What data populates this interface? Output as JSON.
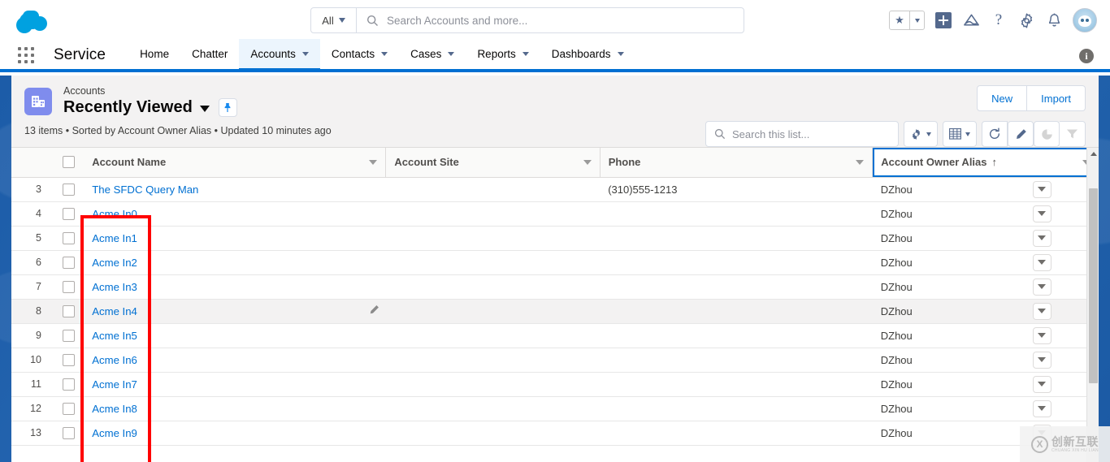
{
  "header": {
    "logo_icon": "salesforce-cloud-logo",
    "search": {
      "scope_label": "All",
      "placeholder": "Search Accounts and more...",
      "value": "",
      "search_icon": "search-icon"
    },
    "icons": [
      {
        "name": "favorites-star-icon",
        "glyph": "★"
      },
      {
        "name": "favorites-dropdown-icon",
        "glyph": ""
      },
      {
        "name": "add-icon",
        "glyph": "+"
      },
      {
        "name": "trailhead-icon",
        "glyph": ""
      },
      {
        "name": "help-icon",
        "glyph": "?"
      },
      {
        "name": "setup-gear-icon",
        "glyph": ""
      },
      {
        "name": "notifications-bell-icon",
        "glyph": ""
      },
      {
        "name": "user-avatar",
        "glyph": ""
      }
    ]
  },
  "nav": {
    "app_launcher_icon": "app-launcher-grid-icon",
    "app_name": "Service",
    "info_icon_label": "i",
    "tabs": [
      {
        "label": "Home",
        "has_chevron": false,
        "active": false
      },
      {
        "label": "Chatter",
        "has_chevron": false,
        "active": false
      },
      {
        "label": "Accounts",
        "has_chevron": true,
        "active": true
      },
      {
        "label": "Contacts",
        "has_chevron": true,
        "active": false
      },
      {
        "label": "Cases",
        "has_chevron": true,
        "active": false
      },
      {
        "label": "Reports",
        "has_chevron": true,
        "active": false
      },
      {
        "label": "Dashboards",
        "has_chevron": true,
        "active": false
      }
    ]
  },
  "list_view": {
    "object_icon": "account-building-icon",
    "breadcrumb": "Accounts",
    "title": "Recently Viewed",
    "pin_icon": "pin-icon",
    "meta": "13 items • Sorted by Account Owner Alias • Updated 10 minutes ago",
    "buttons": {
      "new_label": "New",
      "import_label": "Import"
    },
    "search": {
      "placeholder": "Search this list...",
      "value": "",
      "search_icon": "search-icon"
    },
    "tools": [
      {
        "name": "list-view-controls-gear",
        "icon": "gear-icon",
        "has_caret": true,
        "disabled": false
      },
      {
        "name": "display-as-table",
        "icon": "table-icon",
        "has_caret": true,
        "disabled": false
      },
      {
        "name": "refresh-button",
        "icon": "refresh-icon",
        "has_caret": false,
        "disabled": false
      },
      {
        "name": "edit-button",
        "icon": "pencil-icon",
        "has_caret": false,
        "disabled": false
      },
      {
        "name": "charts-button",
        "icon": "chart-icon",
        "has_caret": false,
        "disabled": true
      },
      {
        "name": "filter-button",
        "icon": "filter-icon",
        "has_caret": false,
        "disabled": true
      }
    ]
  },
  "table": {
    "select_all_checkbox": false,
    "columns": [
      {
        "key": "name",
        "label": "Account Name",
        "sorted": false,
        "sort_dir": ""
      },
      {
        "key": "site",
        "label": "Account Site",
        "sorted": false,
        "sort_dir": ""
      },
      {
        "key": "phone",
        "label": "Phone",
        "sorted": false,
        "sort_dir": ""
      },
      {
        "key": "owner",
        "label": "Account Owner Alias",
        "sorted": true,
        "sort_dir": "↑"
      }
    ],
    "rows": [
      {
        "num": "3",
        "name": "The SFDC Query Man",
        "site": "",
        "phone": "(310)555-1213",
        "owner": "DZhou",
        "hover": false
      },
      {
        "num": "4",
        "name": "Acme In0",
        "site": "",
        "phone": "",
        "owner": "DZhou",
        "hover": false
      },
      {
        "num": "5",
        "name": "Acme In1",
        "site": "",
        "phone": "",
        "owner": "DZhou",
        "hover": false
      },
      {
        "num": "6",
        "name": "Acme In2",
        "site": "",
        "phone": "",
        "owner": "DZhou",
        "hover": false
      },
      {
        "num": "7",
        "name": "Acme In3",
        "site": "",
        "phone": "",
        "owner": "DZhou",
        "hover": false
      },
      {
        "num": "8",
        "name": "Acme In4",
        "site": "",
        "phone": "",
        "owner": "DZhou",
        "hover": true
      },
      {
        "num": "9",
        "name": "Acme In5",
        "site": "",
        "phone": "",
        "owner": "DZhou",
        "hover": false
      },
      {
        "num": "10",
        "name": "Acme In6",
        "site": "",
        "phone": "",
        "owner": "DZhou",
        "hover": false
      },
      {
        "num": "11",
        "name": "Acme In7",
        "site": "",
        "phone": "",
        "owner": "DZhou",
        "hover": false
      },
      {
        "num": "12",
        "name": "Acme In8",
        "site": "",
        "phone": "",
        "owner": "DZhou",
        "hover": false
      },
      {
        "num": "13",
        "name": "Acme In9",
        "site": "",
        "phone": "",
        "owner": "DZhou",
        "hover": false
      }
    ]
  },
  "annotation": {
    "color": "#ff0000",
    "target": "account-name-column-cells"
  },
  "watermark": {
    "logo_text": "X",
    "chinese": "创新互联",
    "pinyin": "CHUANG XIN HU LIAN"
  },
  "colors": {
    "brand_blue": "#0070d2",
    "link_blue": "#0070d2",
    "logo_blue": "#00A1E0",
    "object_icon_purple": "#7f8ced",
    "page_bg": "#1c5ca8",
    "annotation_red": "#ff0000"
  }
}
